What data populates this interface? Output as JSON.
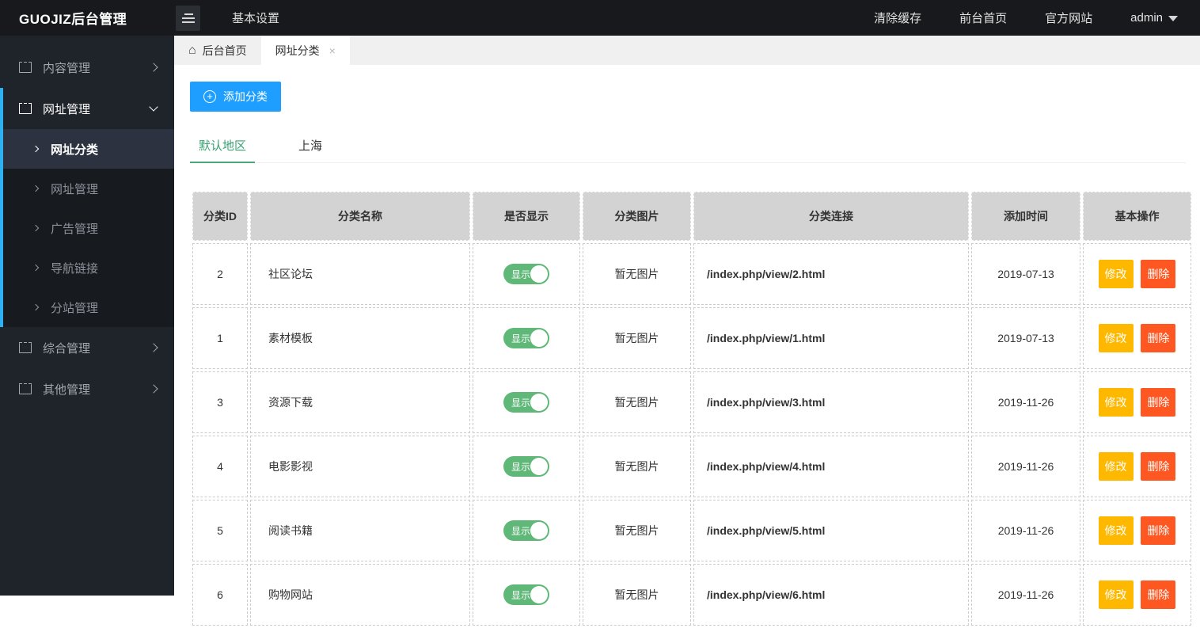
{
  "topbar": {
    "logo": "GUOJIZ后台管理",
    "nav_settings": "基本设置",
    "links": [
      "清除缓存",
      "前台首页",
      "官方网站"
    ],
    "user": "admin"
  },
  "sidebar": {
    "items": [
      {
        "label": "内容管理",
        "expanded": false
      },
      {
        "label": "网址管理",
        "expanded": true,
        "children": [
          "网址分类",
          "网址管理",
          "广告管理",
          "导航链接",
          "分站管理"
        ],
        "active_child": "网址分类"
      },
      {
        "label": "综合管理",
        "expanded": false
      },
      {
        "label": "其他管理",
        "expanded": false
      }
    ]
  },
  "tabs": {
    "home": "后台首页",
    "current": "网址分类",
    "close": "×"
  },
  "toolbar": {
    "add_label": "添加分类"
  },
  "region_tabs": [
    {
      "label": "默认地区",
      "active": true
    },
    {
      "label": "上海",
      "active": false
    }
  ],
  "table": {
    "headers": [
      "分类ID",
      "分类名称",
      "是否显示",
      "分类图片",
      "分类连接",
      "添加时间",
      "基本操作"
    ],
    "toggle_label": "显示",
    "edit_label": "修改",
    "delete_label": "删除",
    "rows": [
      {
        "id": "2",
        "name": "社区论坛",
        "visible": "显示",
        "image": "暂无图片",
        "link": "/index.php/view/2.html",
        "date": "2019-07-13"
      },
      {
        "id": "1",
        "name": "素材模板",
        "visible": "显示",
        "image": "暂无图片",
        "link": "/index.php/view/1.html",
        "date": "2019-07-13"
      },
      {
        "id": "3",
        "name": "资源下载",
        "visible": "显示",
        "image": "暂无图片",
        "link": "/index.php/view/3.html",
        "date": "2019-11-26"
      },
      {
        "id": "4",
        "name": "电影影视",
        "visible": "显示",
        "image": "暂无图片",
        "link": "/index.php/view/4.html",
        "date": "2019-11-26"
      },
      {
        "id": "5",
        "name": "阅读书籍",
        "visible": "显示",
        "image": "暂无图片",
        "link": "/index.php/view/5.html",
        "date": "2019-11-26"
      },
      {
        "id": "6",
        "name": "购物网站",
        "visible": "显示",
        "image": "暂无图片",
        "link": "/index.php/view/6.html",
        "date": "2019-11-26"
      }
    ]
  },
  "colors": {
    "accent_blue": "#1E9FFF",
    "toggle_green": "#5FB878",
    "edit_yellow": "#FFB800",
    "delete_red": "#FF5722",
    "active_strip_blue": "#2eb1f3",
    "active_tab_green": "#38a273"
  }
}
